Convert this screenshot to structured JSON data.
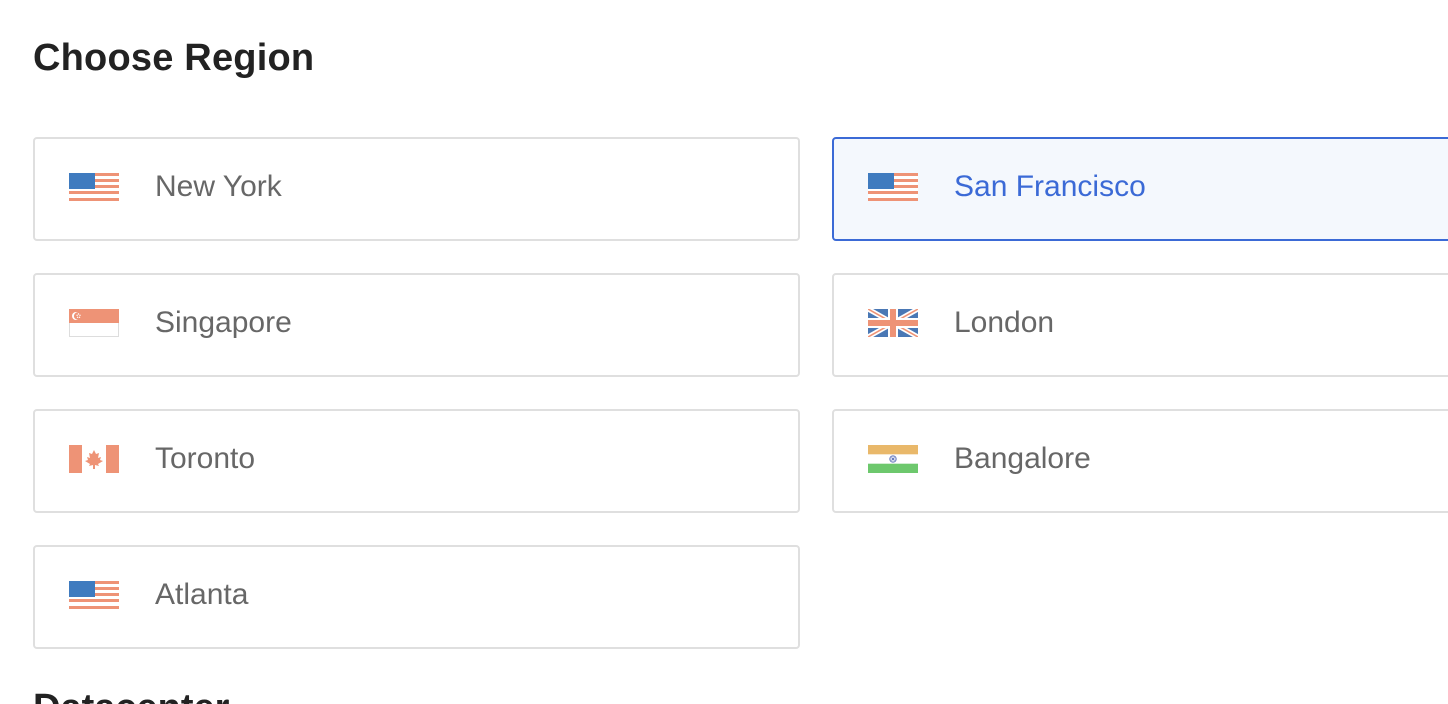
{
  "section_title": "Choose Region",
  "next_section_title": "Datacenter",
  "colors": {
    "selected_border": "#3b6ad6",
    "selected_background": "#f4f8fd",
    "card_border": "#dfdfdf",
    "label_text": "#676767",
    "title_text": "#222222"
  },
  "selected_region": "San Francisco",
  "regions": [
    {
      "label": "New York",
      "flag": "us-flag-icon",
      "selected": false
    },
    {
      "label": "San Francisco",
      "flag": "us-flag-icon",
      "selected": true
    },
    {
      "label": "Singapore",
      "flag": "singapore-flag-icon",
      "selected": false
    },
    {
      "label": "London",
      "flag": "uk-flag-icon",
      "selected": false
    },
    {
      "label": "Toronto",
      "flag": "canada-flag-icon",
      "selected": false
    },
    {
      "label": "Bangalore",
      "flag": "india-flag-icon",
      "selected": false
    },
    {
      "label": "Atlanta",
      "flag": "us-flag-icon",
      "selected": false
    }
  ]
}
